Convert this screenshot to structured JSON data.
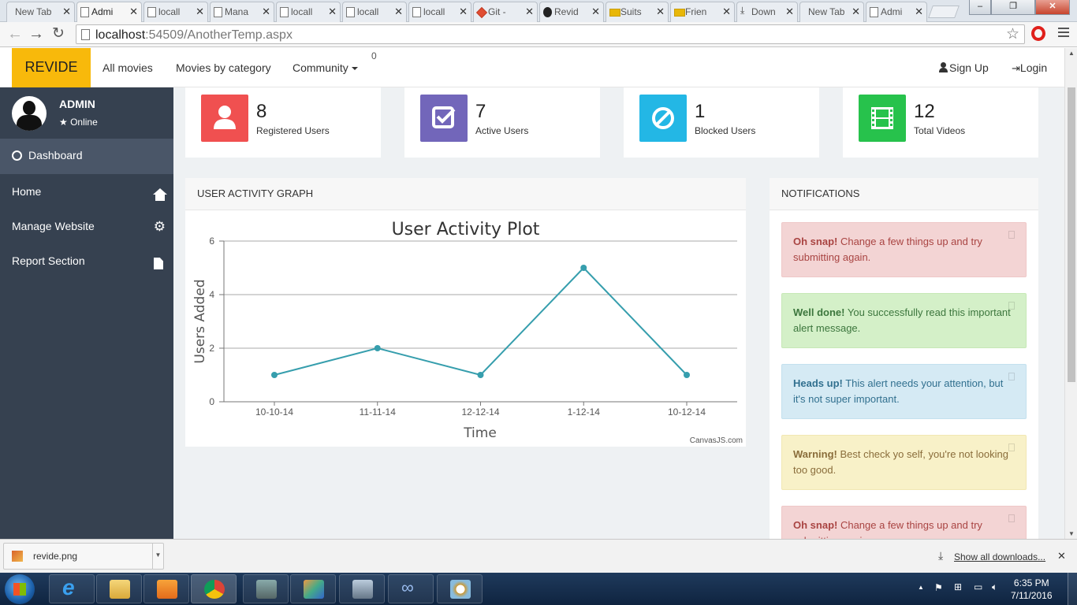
{
  "browser": {
    "tabs": [
      {
        "label": "New Tab",
        "icon": "none"
      },
      {
        "label": "Admi",
        "icon": "page",
        "active": true
      },
      {
        "label": "locall",
        "icon": "page"
      },
      {
        "label": "Mana",
        "icon": "page"
      },
      {
        "label": "locall",
        "icon": "page"
      },
      {
        "label": "locall",
        "icon": "page"
      },
      {
        "label": "locall",
        "icon": "page"
      },
      {
        "label": "Git -",
        "icon": "git"
      },
      {
        "label": "Revid",
        "icon": "github"
      },
      {
        "label": "Suits",
        "icon": "imdb"
      },
      {
        "label": "Frien",
        "icon": "imdb"
      },
      {
        "label": "Down",
        "icon": "download"
      },
      {
        "label": "New Tab",
        "icon": "none"
      },
      {
        "label": "Admi",
        "icon": "page"
      }
    ],
    "url_host": "localhost",
    "url_rest": ":54509/AnotherTemp.aspx"
  },
  "nav": {
    "brand": "REVIDE",
    "links": [
      "All movies",
      "Movies by category",
      "Community"
    ],
    "count": "0",
    "signup": "Sign Up",
    "login": "Login"
  },
  "sidebar": {
    "user_name": "ADMIN",
    "status": "Online",
    "items": [
      {
        "label": "Dashboard",
        "icon": "dashboard-icon"
      },
      {
        "label": "Home",
        "icon": "home-icon"
      },
      {
        "label": "Manage Website",
        "icon": "gear-icon"
      },
      {
        "label": "Report Section",
        "icon": "document-icon"
      }
    ]
  },
  "stats": [
    {
      "value": "8",
      "label": "Registered Users",
      "color": "#f05050",
      "icon": "user-icon"
    },
    {
      "value": "7",
      "label": "Active Users",
      "color": "#7266ba",
      "icon": "check-icon"
    },
    {
      "value": "1",
      "label": "Blocked Users",
      "color": "#23b7e5",
      "icon": "ban-icon"
    },
    {
      "value": "12",
      "label": "Total Videos",
      "color": "#27c24c",
      "icon": "film-icon"
    }
  ],
  "graph_panel": {
    "title": "USER ACTIVITY GRAPH",
    "credit": "CanvasJS.com"
  },
  "chart_data": {
    "type": "line",
    "title": "User Activity Plot",
    "xlabel": "Time",
    "ylabel": "Users Added",
    "categories": [
      "10-10-14",
      "11-11-14",
      "12-12-14",
      "1-12-14",
      "10-12-14"
    ],
    "values": [
      1,
      2,
      1,
      5,
      1
    ],
    "ylim": [
      0,
      6
    ],
    "yticks": [
      0,
      2,
      4,
      6
    ],
    "grid": true,
    "color": "#369ead"
  },
  "notifications": {
    "title": "NOTIFICATIONS",
    "alerts": [
      {
        "type": "danger",
        "strong": "Oh snap!",
        "text": " Change a few things up and try submitting again."
      },
      {
        "type": "success",
        "strong": "Well done!",
        "text": " You successfully read this important alert message."
      },
      {
        "type": "info",
        "strong": "Heads up!",
        "text": " This alert needs your attention, but it's not super important."
      },
      {
        "type": "warning",
        "strong": "Warning!",
        "text": " Best check yo self, you're not looking too good."
      },
      {
        "type": "danger",
        "strong": "Oh snap!",
        "text": " Change a few things up and try submitting again."
      }
    ]
  },
  "downloads": {
    "file": "revide.png",
    "show_all": "Show all downloads..."
  },
  "taskbar": {
    "time": "6:35 PM",
    "date": "7/11/2016"
  }
}
